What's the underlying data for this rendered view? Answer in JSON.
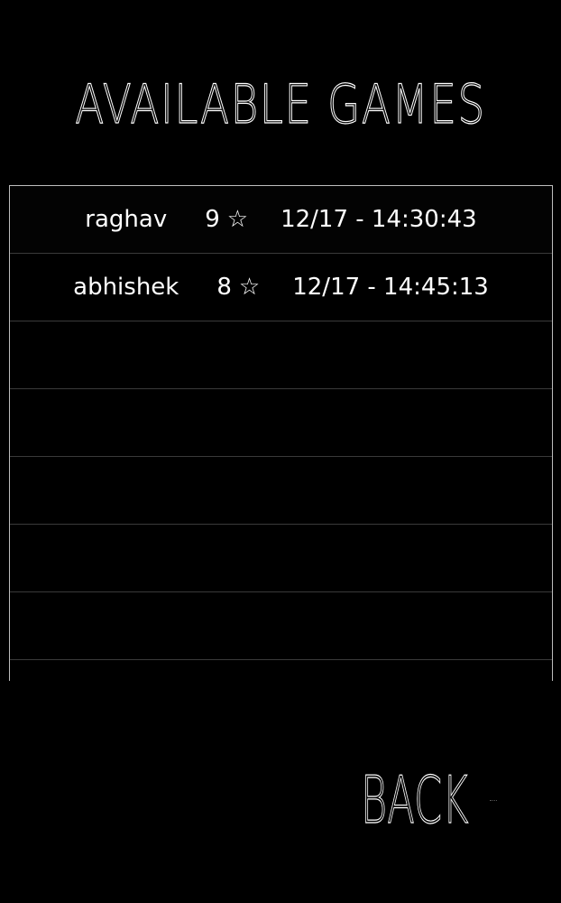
{
  "screen": {
    "title": "AVAILABLE GAMES",
    "back_label": "BACK"
  },
  "games": [
    {
      "player": "raghav",
      "stars": "9",
      "star_icon": "star-outline-icon",
      "datetime": "12/17 - 14:30:43"
    },
    {
      "player": "abhishek",
      "stars": "8",
      "star_icon": "star-outline-icon",
      "datetime": "12/17 - 14:45:13"
    }
  ],
  "colors": {
    "background": "#000000",
    "text": "#ffffff",
    "frame": "#bdbdbd",
    "divider": "#3a3a3a"
  }
}
